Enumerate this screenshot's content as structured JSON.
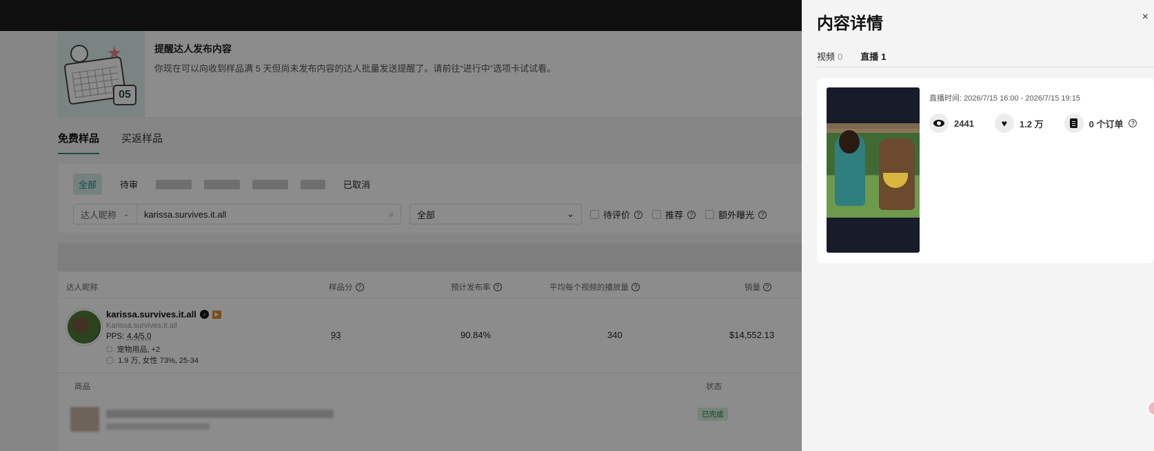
{
  "banner": {
    "title": "提醒达人发布内容",
    "desc": "你现在可以向收到样品满 5 天但尚未发布内容的达人批量发送提醒了。请前往“进行中”选项卡试试看。",
    "badge_number": "05"
  },
  "tabs": [
    {
      "label": "免费样品",
      "active": true
    },
    {
      "label": "买返样品",
      "active": false
    }
  ],
  "status_filters": {
    "all": "全部",
    "pending_partial": "待审",
    "cancelled": "已取消"
  },
  "search": {
    "field_select": "达人昵称",
    "value": "karissa.survives.it.all"
  },
  "dropdown": {
    "selected": "全部"
  },
  "checkboxes": [
    {
      "label": "待评价"
    },
    {
      "label": "推荐"
    },
    {
      "label": "额外曝光"
    }
  ],
  "table": {
    "headers": {
      "creator": "达人昵称",
      "sample_score": "样品分",
      "est_post_rate": "预计发布率",
      "avg_views": "平均每个视频的播放量",
      "sales": "销量"
    },
    "row": {
      "name": "karissa.survives.it.all",
      "handle": "Karissa.survives.it.all",
      "pps_label": "PPS:",
      "pps_value": "4.4/5.0",
      "category": "宠物用品, +2",
      "audience": "1.9 万, 女性 73%, 25-34",
      "sample_score": "93",
      "est_post_rate": "90.84%",
      "avg_views": "340",
      "sales": "$14,552.13"
    },
    "sub_headers": {
      "product": "商品",
      "status": "状态"
    },
    "product_status": "已完成"
  },
  "panel": {
    "title": "内容详情",
    "close": "×",
    "tabs": [
      {
        "label": "视频",
        "count": "0",
        "active": false
      },
      {
        "label": "直播",
        "count": "1",
        "active": true
      }
    ],
    "live": {
      "time": "直播时间:  2026/7/15 16:00 - 2026/7/15 19:15",
      "views": "2441",
      "likes": "1.2 万",
      "orders": "0 个订单"
    }
  },
  "colors": {
    "accent": "#1a8a84",
    "overlay": "rgba(0,0,0,0.45)",
    "done": "#1e7a3e"
  }
}
